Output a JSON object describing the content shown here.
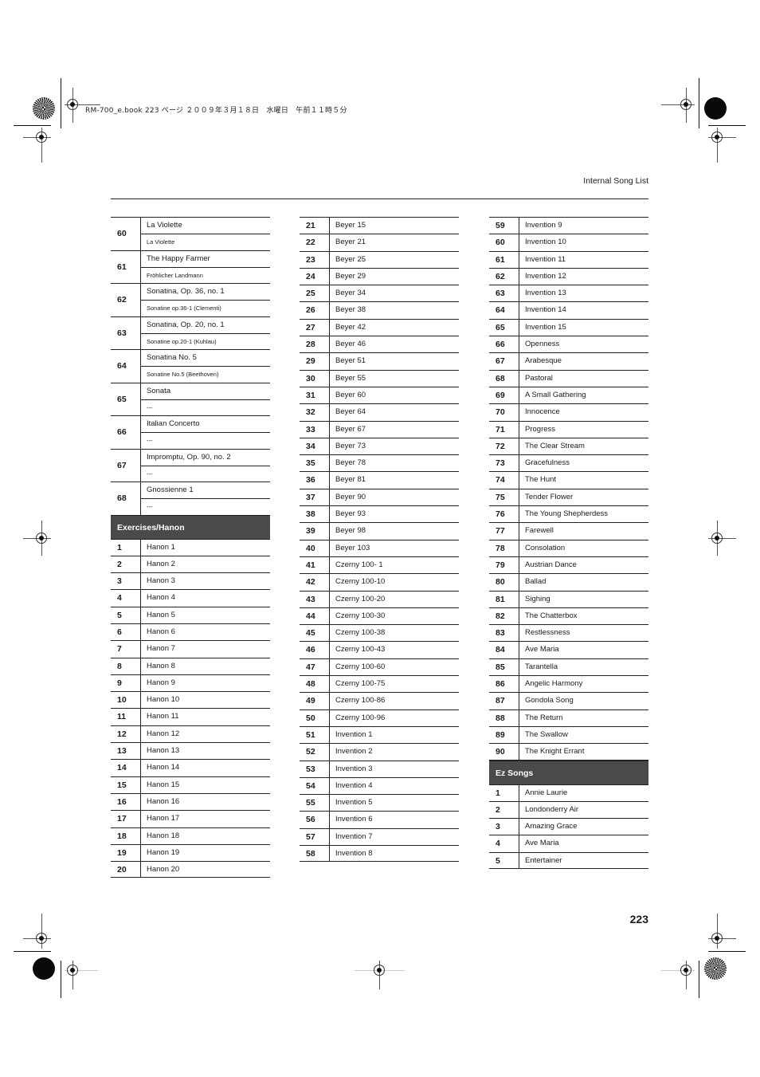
{
  "print_line": "RM-700_e.book  223 ページ  ２００９年３月１８日　水曜日　午前１１時５分",
  "header": {
    "title": "Internal Song List"
  },
  "page_number": "223",
  "column1": {
    "grouped_entries": [
      {
        "number": "60",
        "title": "La Violette",
        "subtitle": "La Violette"
      },
      {
        "number": "61",
        "title": "The Happy Farmer",
        "subtitle": "Fröhlicher Landmann"
      },
      {
        "number": "62",
        "title": "Sonatina, Op. 36, no. 1",
        "subtitle": "Sonatine op.36-1 (Clementi)"
      },
      {
        "number": "63",
        "title": "Sonatina, Op. 20, no. 1",
        "subtitle": "Sonatine op.20-1 (Kuhlau)"
      },
      {
        "number": "64",
        "title": "Sonatina No. 5",
        "subtitle": "Sonatine No.5 (Beethoven)"
      },
      {
        "number": "65",
        "title": "Sonata",
        "subtitle": "---"
      },
      {
        "number": "66",
        "title": "Italian Concerto",
        "subtitle": "---"
      },
      {
        "number": "67",
        "title": "Impromptu, Op. 90, no. 2",
        "subtitle": "---"
      },
      {
        "number": "68",
        "title": "Gnossienne 1",
        "subtitle": "---"
      }
    ],
    "section_title": "Exercises/Hanon",
    "entries": [
      {
        "number": "1",
        "title": "Hanon 1"
      },
      {
        "number": "2",
        "title": "Hanon 2"
      },
      {
        "number": "3",
        "title": "Hanon 3"
      },
      {
        "number": "4",
        "title": "Hanon 4"
      },
      {
        "number": "5",
        "title": "Hanon 5"
      },
      {
        "number": "6",
        "title": "Hanon 6"
      },
      {
        "number": "7",
        "title": "Hanon 7"
      },
      {
        "number": "8",
        "title": "Hanon 8"
      },
      {
        "number": "9",
        "title": "Hanon 9"
      },
      {
        "number": "10",
        "title": "Hanon 10"
      },
      {
        "number": "11",
        "title": "Hanon 11"
      },
      {
        "number": "12",
        "title": "Hanon 12"
      },
      {
        "number": "13",
        "title": "Hanon 13"
      },
      {
        "number": "14",
        "title": "Hanon 14"
      },
      {
        "number": "15",
        "title": "Hanon 15"
      },
      {
        "number": "16",
        "title": "Hanon 16"
      },
      {
        "number": "17",
        "title": "Hanon 17"
      },
      {
        "number": "18",
        "title": "Hanon 18"
      },
      {
        "number": "19",
        "title": "Hanon 19"
      },
      {
        "number": "20",
        "title": "Hanon 20"
      }
    ]
  },
  "column2": {
    "entries": [
      {
        "number": "21",
        "title": "Beyer 15"
      },
      {
        "number": "22",
        "title": "Beyer 21"
      },
      {
        "number": "23",
        "title": "Beyer 25"
      },
      {
        "number": "24",
        "title": "Beyer 29"
      },
      {
        "number": "25",
        "title": "Beyer 34"
      },
      {
        "number": "26",
        "title": "Beyer 38"
      },
      {
        "number": "27",
        "title": "Beyer 42"
      },
      {
        "number": "28",
        "title": "Beyer 46"
      },
      {
        "number": "29",
        "title": "Beyer 51"
      },
      {
        "number": "30",
        "title": "Beyer 55"
      },
      {
        "number": "31",
        "title": "Beyer 60"
      },
      {
        "number": "32",
        "title": "Beyer 64"
      },
      {
        "number": "33",
        "title": "Beyer 67"
      },
      {
        "number": "34",
        "title": "Beyer 73"
      },
      {
        "number": "35",
        "title": "Beyer 78"
      },
      {
        "number": "36",
        "title": "Beyer 81"
      },
      {
        "number": "37",
        "title": "Beyer 90"
      },
      {
        "number": "38",
        "title": "Beyer 93"
      },
      {
        "number": "39",
        "title": "Beyer 98"
      },
      {
        "number": "40",
        "title": "Beyer 103"
      },
      {
        "number": "41",
        "title": "Czerny 100- 1"
      },
      {
        "number": "42",
        "title": "Czerny 100-10"
      },
      {
        "number": "43",
        "title": "Czerny 100-20"
      },
      {
        "number": "44",
        "title": "Czerny 100-30"
      },
      {
        "number": "45",
        "title": "Czerny 100-38"
      },
      {
        "number": "46",
        "title": "Czerny 100-43"
      },
      {
        "number": "47",
        "title": "Czerny 100-60"
      },
      {
        "number": "48",
        "title": "Czerny 100-75"
      },
      {
        "number": "49",
        "title": "Czerny 100-86"
      },
      {
        "number": "50",
        "title": "Czerny 100-96"
      },
      {
        "number": "51",
        "title": "Invention 1"
      },
      {
        "number": "52",
        "title": "Invention 2"
      },
      {
        "number": "53",
        "title": "Invention 3"
      },
      {
        "number": "54",
        "title": "Invention 4"
      },
      {
        "number": "55",
        "title": "Invention 5"
      },
      {
        "number": "56",
        "title": "Invention 6"
      },
      {
        "number": "57",
        "title": "Invention 7"
      },
      {
        "number": "58",
        "title": "Invention 8"
      }
    ]
  },
  "column3": {
    "entries": [
      {
        "number": "59",
        "title": "Invention 9"
      },
      {
        "number": "60",
        "title": "Invention 10"
      },
      {
        "number": "61",
        "title": "Invention 11"
      },
      {
        "number": "62",
        "title": "Invention 12"
      },
      {
        "number": "63",
        "title": "Invention 13"
      },
      {
        "number": "64",
        "title": "Invention 14"
      },
      {
        "number": "65",
        "title": "Invention 15"
      },
      {
        "number": "66",
        "title": "Openness"
      },
      {
        "number": "67",
        "title": "Arabesque"
      },
      {
        "number": "68",
        "title": "Pastoral"
      },
      {
        "number": "69",
        "title": "A Small Gathering"
      },
      {
        "number": "70",
        "title": "Innocence"
      },
      {
        "number": "71",
        "title": "Progress"
      },
      {
        "number": "72",
        "title": "The Clear Stream"
      },
      {
        "number": "73",
        "title": "Gracefulness"
      },
      {
        "number": "74",
        "title": "The Hunt"
      },
      {
        "number": "75",
        "title": "Tender Flower"
      },
      {
        "number": "76",
        "title": "The Young Shepherdess"
      },
      {
        "number": "77",
        "title": "Farewell"
      },
      {
        "number": "78",
        "title": "Consolation"
      },
      {
        "number": "79",
        "title": "Austrian Dance"
      },
      {
        "number": "80",
        "title": "Ballad"
      },
      {
        "number": "81",
        "title": "Sighing"
      },
      {
        "number": "82",
        "title": "The Chatterbox"
      },
      {
        "number": "83",
        "title": "Restlessness"
      },
      {
        "number": "84",
        "title": "Ave Maria"
      },
      {
        "number": "85",
        "title": "Tarantella"
      },
      {
        "number": "86",
        "title": "Angelic Harmony"
      },
      {
        "number": "87",
        "title": "Gondola Song"
      },
      {
        "number": "88",
        "title": "The Return"
      },
      {
        "number": "89",
        "title": "The Swallow"
      },
      {
        "number": "90",
        "title": "The Knight Errant"
      }
    ],
    "section_title": "Ez Songs",
    "section_entries": [
      {
        "number": "1",
        "title": "Annie Laurie"
      },
      {
        "number": "2",
        "title": "Londonderry Air"
      },
      {
        "number": "3",
        "title": "Amazing Grace"
      },
      {
        "number": "4",
        "title": "Ave Maria"
      },
      {
        "number": "5",
        "title": "Entertainer"
      }
    ]
  },
  "colors": {
    "section_header_bg": "#4a4a4a",
    "section_header_text": "#ffffff",
    "rule": "#222222"
  }
}
